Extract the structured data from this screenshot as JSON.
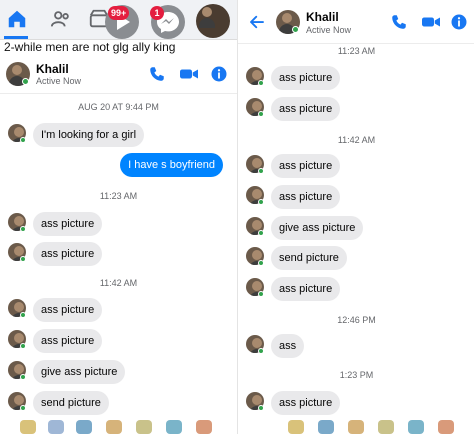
{
  "colors": {
    "accent": "#1877f2",
    "messenger_blue": "#0084ff",
    "bubble_grey": "#e9e9eb",
    "online": "#31a24c",
    "badge_red": "#e41e3f"
  },
  "left": {
    "nav": {
      "icons": [
        "home-icon",
        "friends-icon",
        "marketplace-icon",
        "video-icon",
        "messenger-icon"
      ],
      "badge_video": "99+",
      "badge_messenger": "1"
    },
    "caption": "2-while men are not glg ally king",
    "header": {
      "name": "Khalil",
      "status": "Active Now"
    },
    "timestamps": [
      "AUG 20 AT 9:44 PM",
      "11:23 AM",
      "11:42 AM"
    ],
    "messages": [
      {
        "text": "I'm looking for a girl",
        "from": "them"
      },
      {
        "text": "I have s boyfriend",
        "from": "me"
      },
      {
        "text": "ass picture",
        "from": "them"
      },
      {
        "text": "ass picture",
        "from": "them"
      },
      {
        "text": "ass picture",
        "from": "them"
      },
      {
        "text": "ass picture",
        "from": "them"
      },
      {
        "text": "give ass picture",
        "from": "them"
      },
      {
        "text": "send picture",
        "from": "them"
      }
    ]
  },
  "right": {
    "header": {
      "name": "Khalil",
      "status": "Active Now"
    },
    "timestamps": [
      "11:23 AM",
      "11:42 AM",
      "12:46 PM",
      "1:23 PM"
    ],
    "messages": [
      {
        "text": "ass picture",
        "from": "them"
      },
      {
        "text": "ass picture",
        "from": "them"
      },
      {
        "text": "ass picture",
        "from": "them"
      },
      {
        "text": "ass picture",
        "from": "them"
      },
      {
        "text": "give ass picture",
        "from": "them"
      },
      {
        "text": "send picture",
        "from": "them"
      },
      {
        "text": "ass picture",
        "from": "them"
      },
      {
        "text": "ass",
        "from": "them"
      },
      {
        "text": "ass picture",
        "from": "them"
      }
    ]
  }
}
